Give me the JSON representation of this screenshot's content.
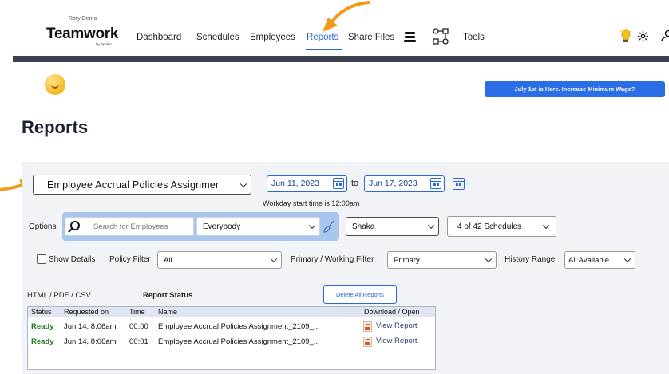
{
  "header": {
    "company": "Rory Demo",
    "brand": "Teamwork",
    "brand_by": "by Spokin",
    "nav": [
      {
        "label": "Dashboard",
        "active": false
      },
      {
        "label": "Schedules",
        "active": false
      },
      {
        "label": "Employees",
        "active": false
      },
      {
        "label": "Reports",
        "active": true
      },
      {
        "label": "Share Files",
        "active": false
      },
      {
        "label": "Tools",
        "active": false
      }
    ],
    "icons": [
      "stack-icon",
      "workflow-icon",
      "lightbulb-icon",
      "gear-icon",
      "user-icon"
    ]
  },
  "banner": {
    "text": "July 1st is Here. Increase Minimum Wage?"
  },
  "page": {
    "title": "Reports"
  },
  "filters": {
    "report_type": "Employee Accrual Policies Assignmer",
    "start_date": "Jun 11, 2023",
    "to_label": "to",
    "end_date": "Jun 17, 2023",
    "workday_note": "Workday start time is 12:00am",
    "options_label": "Options",
    "search_placeholder": "Search for Employees",
    "employee_group": "Everybody",
    "location": "Shaka",
    "schedules": "4 of 42 Schedules",
    "show_details_label": "Show Details",
    "show_details_checked": false,
    "policy_filter_label": "Policy Filter",
    "policy_filter": "All",
    "primary_filter_label": "Primary / Working Filter",
    "primary_filter": "Primary",
    "history_range_label": "History Range",
    "history_range": "All Available"
  },
  "reports": {
    "formats_label": "HTML / PDF / CSV",
    "status_label": "Report Status",
    "delete_all_label": "Delete All Reports",
    "columns": [
      "Status",
      "Requested on",
      "Time",
      "Name",
      "Download / Open"
    ],
    "rows": [
      {
        "status": "Ready",
        "requested": "Jun 14, 8:06am",
        "time": "00:00",
        "name": "Employee Accrual Policies Assignment_2109_...",
        "action": "View Report"
      },
      {
        "status": "Ready",
        "requested": "Jun 14, 8:06am",
        "time": "00:01",
        "name": "Employee Accrual Policies Assignment_2109_...",
        "action": "View Report"
      }
    ]
  },
  "colors": {
    "accent": "#2b67d9",
    "ready": "#1f7a1f",
    "banner": "#2a6de6",
    "arrow": "#f29a1c",
    "navbar": "#3a4150"
  }
}
